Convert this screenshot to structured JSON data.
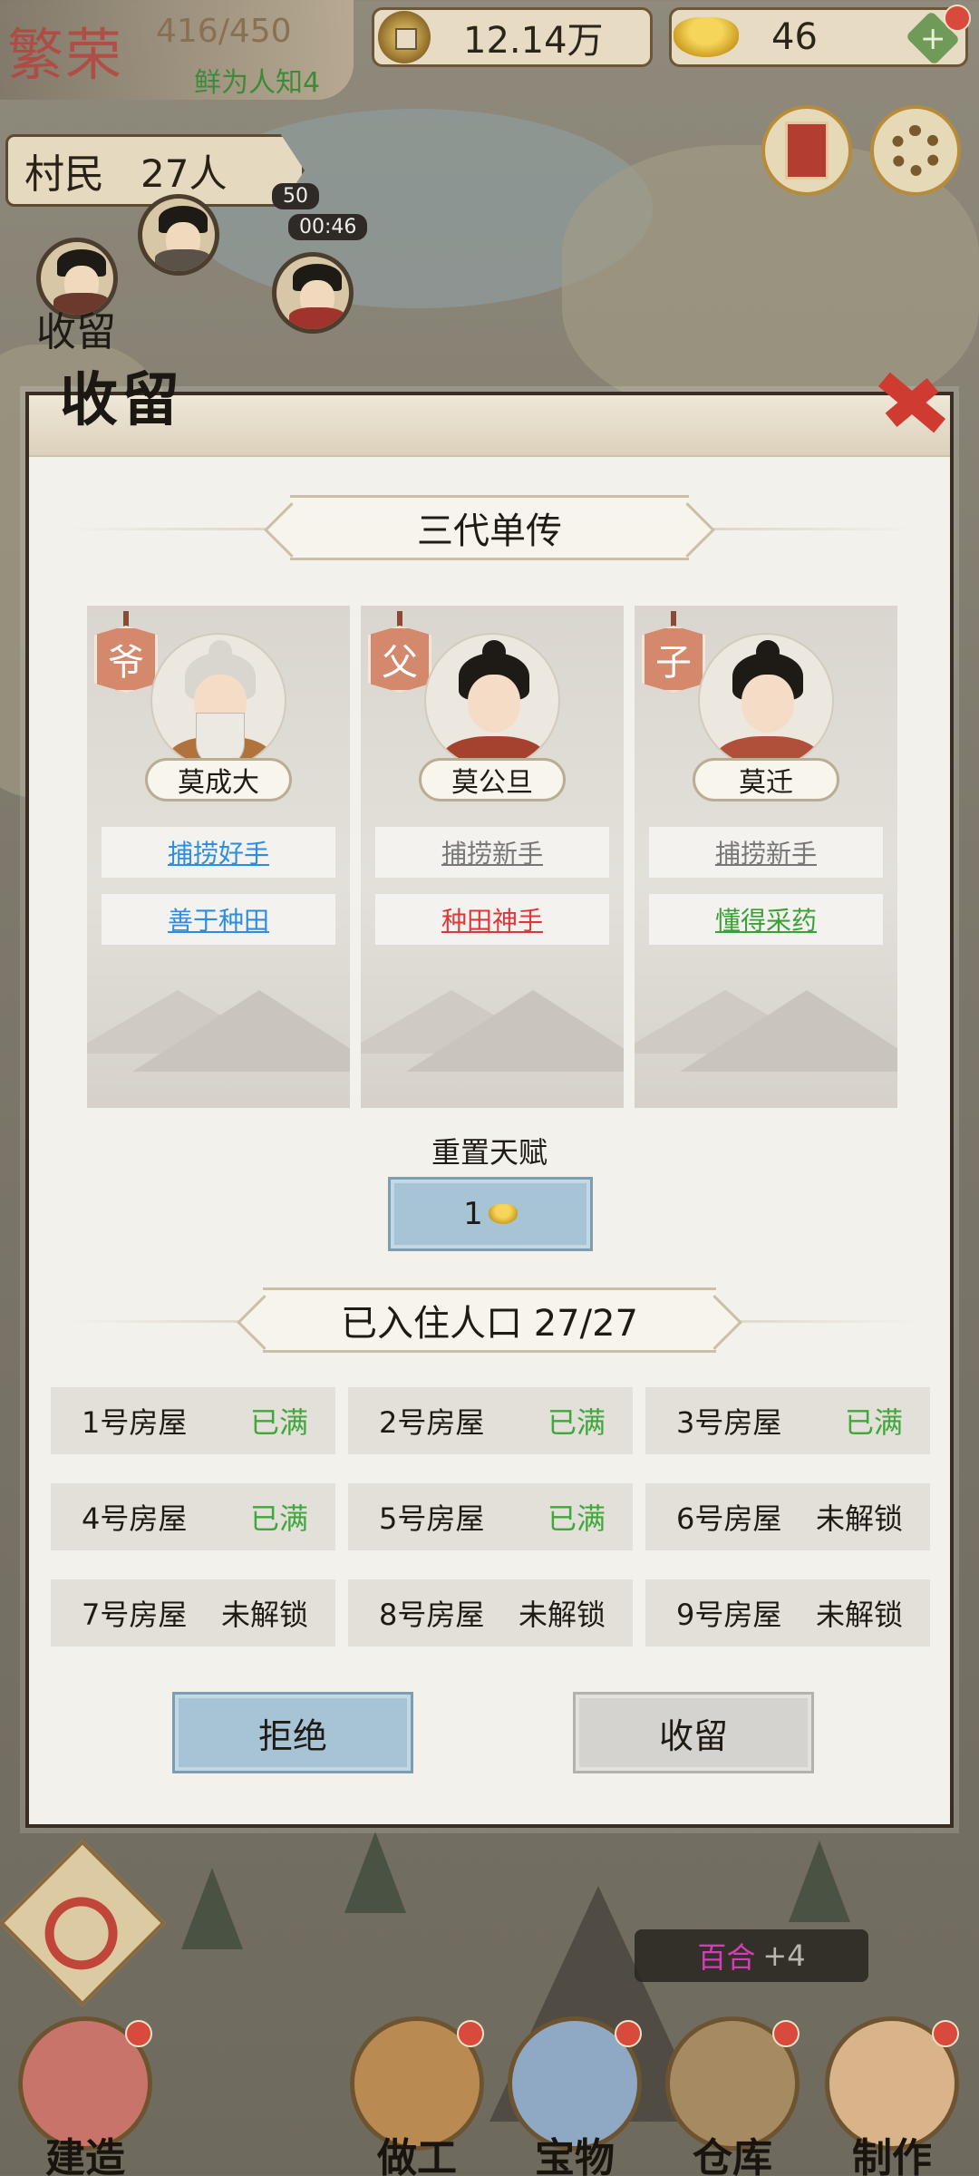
{
  "hud": {
    "prosperity_title": "繁荣",
    "prosperity_value": "416/450",
    "prosperity_rank": "鲜为人知4",
    "coins": "12.14万",
    "ingots": "46",
    "plus_label": "+",
    "villagers_label": "村民",
    "villagers_count": "27人",
    "timer": "00:46",
    "timer_prefix": "50",
    "shelter_label": "收留"
  },
  "dialog": {
    "title": "收留",
    "family_banner": "三代单传",
    "generations": [
      {
        "role": "爷",
        "name": "莫成大",
        "talents": [
          {
            "text": "捕捞好手",
            "color": "blue"
          },
          {
            "text": "善于种田",
            "color": "blue"
          }
        ]
      },
      {
        "role": "父",
        "name": "莫公旦",
        "talents": [
          {
            "text": "捕捞新手",
            "color": "gray"
          },
          {
            "text": "种田神手",
            "color": "red"
          }
        ]
      },
      {
        "role": "子",
        "name": "莫迁",
        "talents": [
          {
            "text": "捕捞新手",
            "color": "gray"
          },
          {
            "text": "懂得采药",
            "color": "green"
          }
        ]
      }
    ],
    "reset_label": "重置天赋",
    "reset_cost": "1",
    "population_banner": "已入住人口 27/27",
    "houses": [
      {
        "name": "1号房屋",
        "status": "已满",
        "state": "full"
      },
      {
        "name": "2号房屋",
        "status": "已满",
        "state": "full"
      },
      {
        "name": "3号房屋",
        "status": "已满",
        "state": "full"
      },
      {
        "name": "4号房屋",
        "status": "已满",
        "state": "full"
      },
      {
        "name": "5号房屋",
        "status": "已满",
        "state": "full"
      },
      {
        "name": "6号房屋",
        "status": "未解锁",
        "state": "locked"
      },
      {
        "name": "7号房屋",
        "status": "未解锁",
        "state": "locked"
      },
      {
        "name": "8号房屋",
        "status": "未解锁",
        "state": "locked"
      },
      {
        "name": "9号房屋",
        "status": "未解锁",
        "state": "locked"
      }
    ],
    "reject_label": "拒绝",
    "accept_label": "收留"
  },
  "toast": {
    "item": "百合",
    "amount": "+4"
  },
  "nav": {
    "build": "建造",
    "work": "做工",
    "treasure": "宝物",
    "warehouse": "仓库",
    "craft": "制作"
  },
  "colors": {
    "blue": "#2e8de0",
    "gray": "#777777",
    "red": "#e0363b",
    "green": "#3aa136",
    "full": "#3fa83a"
  }
}
